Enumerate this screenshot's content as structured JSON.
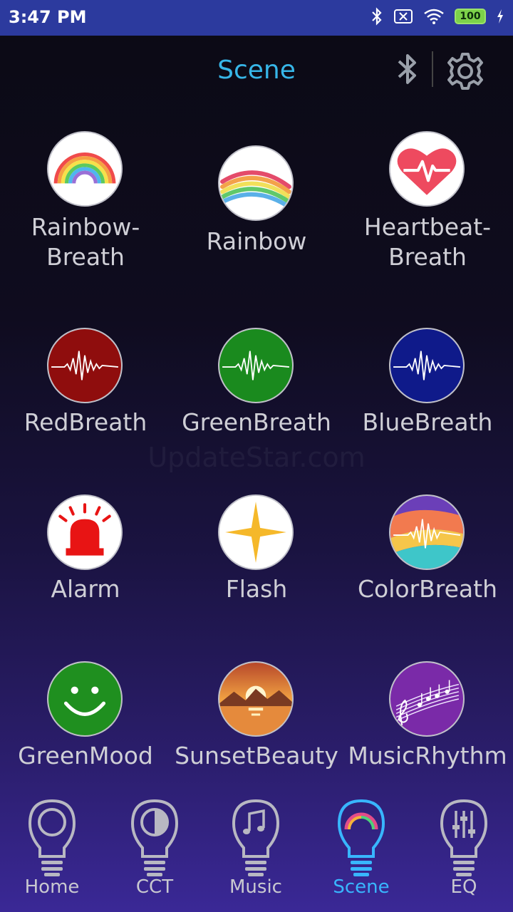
{
  "status": {
    "time": "3:47 PM",
    "battery": "100"
  },
  "header": {
    "title": "Scene"
  },
  "scenes": [
    {
      "label": "Rainbow-\nBreath"
    },
    {
      "label": "Rainbow"
    },
    {
      "label": "Heartbeat-\nBreath"
    },
    {
      "label": "RedBreath"
    },
    {
      "label": "GreenBreath"
    },
    {
      "label": "BlueBreath"
    },
    {
      "label": "Alarm"
    },
    {
      "label": "Flash"
    },
    {
      "label": "ColorBreath"
    },
    {
      "label": "GreenMood"
    },
    {
      "label": "SunsetBeauty"
    },
    {
      "label": "MusicRhythm"
    }
  ],
  "watermark": "UpdateStar.com",
  "nav": [
    {
      "label": "Home"
    },
    {
      "label": "CCT"
    },
    {
      "label": "Music"
    },
    {
      "label": "Scene",
      "active": true
    },
    {
      "label": "EQ"
    }
  ],
  "colors": {
    "accent": "#38b6ff",
    "title": "#37b6e8",
    "statusbar": "#2c3a9e"
  }
}
